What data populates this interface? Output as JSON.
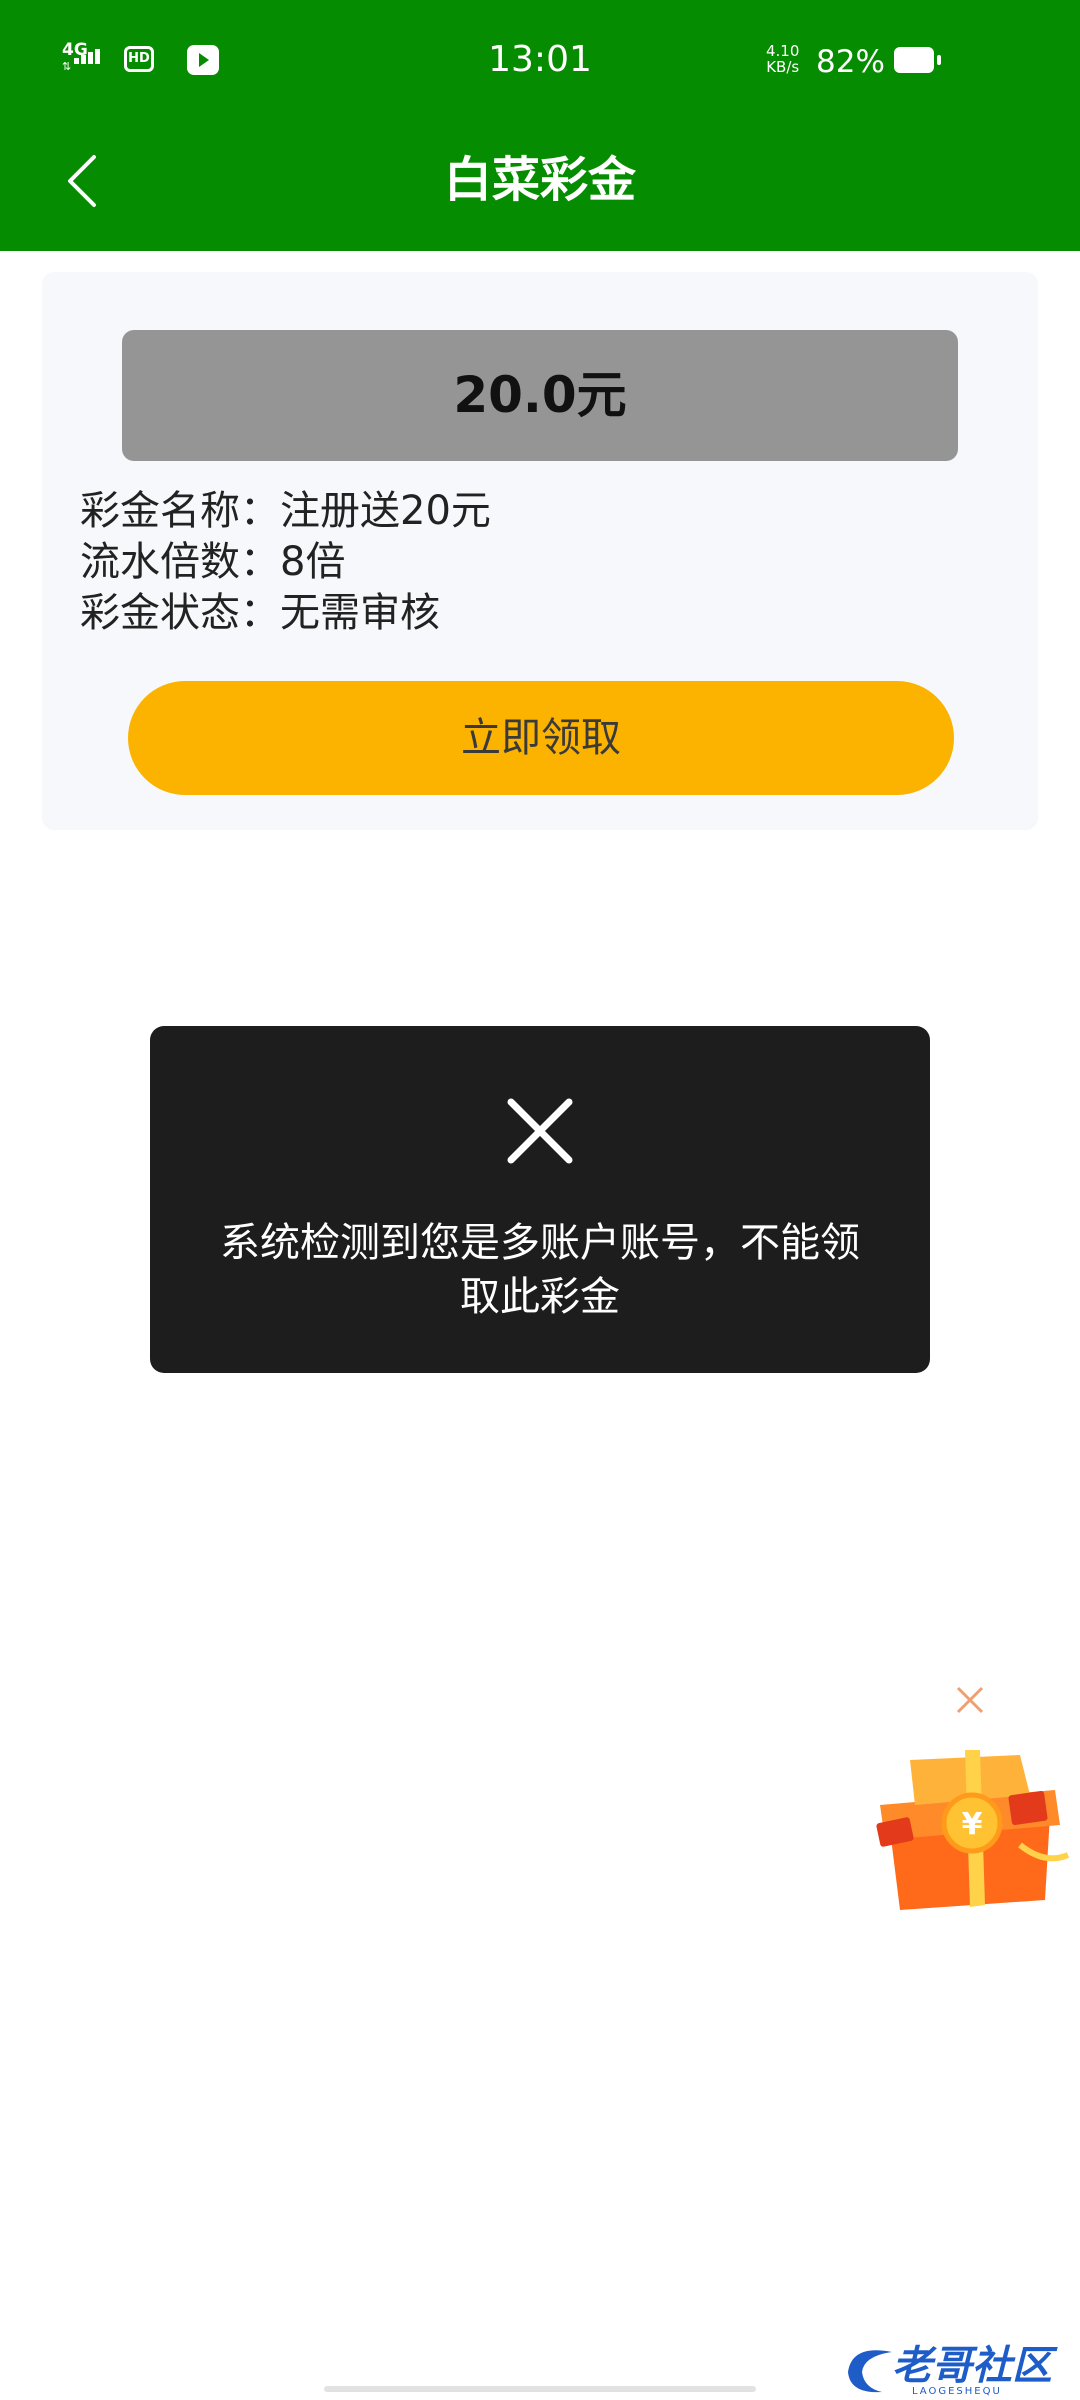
{
  "status_bar": {
    "network": "4G",
    "hd_label": "HD",
    "time": "13:01",
    "speed_value": "4.10",
    "speed_unit": "KB/s",
    "battery": "82%"
  },
  "header": {
    "title": "白菜彩金",
    "background": "#068c00"
  },
  "bonus": {
    "amount": "20.0元",
    "name_label": "彩金名称：",
    "name_value": "注册送20元",
    "turnover_label": "流水倍数：",
    "turnover_value": "8倍",
    "status_label": "彩金状态：",
    "status_value": "无需审核",
    "claim_button": "立即领取",
    "claim_color": "#fcb300"
  },
  "toast": {
    "message": "系统检测到您是多账户账号，不能领取此彩金"
  },
  "watermark": {
    "text": "老哥社区",
    "subtext": "LAOGESHEQU"
  },
  "icons": {
    "back": "chevron-left-icon",
    "toast": "close-x-icon",
    "gift_close": "close-icon",
    "gift": "gift-box-icon"
  }
}
